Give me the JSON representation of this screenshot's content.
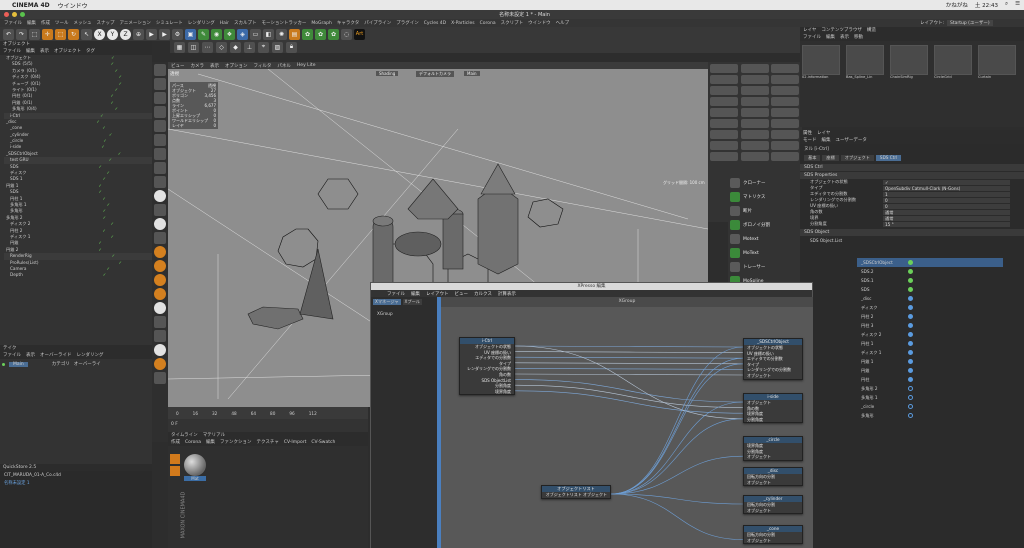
{
  "mac": {
    "app": "CINEMA 4D",
    "menu": "ウインドウ",
    "clock": "土 22:43",
    "user": "かねがね"
  },
  "window_title": "名称未設定 1 * - Main",
  "menubar": [
    "ファイル",
    "編集",
    "作成",
    "ツール",
    "メッシュ",
    "スナップ",
    "アニメーション",
    "シミュレート",
    "レンダリング",
    "Hair",
    "スカルプト",
    "モーショントラッカー",
    "MoGraph",
    "キャラクタ",
    "パイプライン",
    "プラグイン",
    "Cycles 4D",
    "X-Particles",
    "Corona",
    "スクリプト",
    "ウインドウ",
    "ヘルプ"
  ],
  "layout": {
    "label": "レイアウト:",
    "value": "Startup (ユーザー)"
  },
  "toolbar": {
    "x": "X",
    "y": "Y",
    "z": "Z",
    "art": "Art"
  },
  "objects": {
    "header": "オブジェクト",
    "menu": [
      "ファイル",
      "編集",
      "表示",
      "オブジェクト",
      "タグ"
    ],
    "rows": [
      {
        "name": "オブジェクト",
        "v": ""
      },
      {
        "name": "SDS",
        "v": "(5/5)"
      },
      {
        "name": "カメラ",
        "v": "(0/1)"
      },
      {
        "name": "ディスク",
        "v": "(0/4)"
      },
      {
        "name": "チューブ",
        "v": "(0/1)"
      },
      {
        "name": "ライト",
        "v": "(0/1)"
      },
      {
        "name": "円柱",
        "v": "(0/1)"
      },
      {
        "name": "円錐",
        "v": "(0/1)"
      },
      {
        "name": "多角形",
        "v": "(0/4)"
      },
      {
        "name": "i-Ctrl",
        "v": ""
      },
      {
        "name": "_disc",
        "v": ""
      },
      {
        "name": "_cone",
        "v": ""
      },
      {
        "name": "_cylinder",
        "v": ""
      },
      {
        "name": "_circle",
        "v": ""
      },
      {
        "name": "i-side",
        "v": ""
      },
      {
        "name": "_SDSCtrlObject",
        "v": ""
      },
      {
        "name": "test GRU",
        "v": ""
      },
      {
        "name": "SDS",
        "v": ""
      },
      {
        "name": "ディスク",
        "v": ""
      },
      {
        "name": "SDS 1",
        "v": ""
      },
      {
        "name": "円錐 1",
        "v": ""
      },
      {
        "name": "SDS",
        "v": ""
      },
      {
        "name": "円柱 1",
        "v": ""
      },
      {
        "name": "多角形 1",
        "v": ""
      },
      {
        "name": "多角形",
        "v": ""
      },
      {
        "name": "多角形 2",
        "v": ""
      },
      {
        "name": "ディスク 2",
        "v": ""
      },
      {
        "name": "円柱 2",
        "v": ""
      },
      {
        "name": "ディスク 1",
        "v": ""
      },
      {
        "name": "円錐",
        "v": ""
      },
      {
        "name": "円錐 2",
        "v": ""
      },
      {
        "name": "RenderRig",
        "v": ""
      },
      {
        "name": "ProRules(List)",
        "v": ""
      },
      {
        "name": "Camera",
        "v": ""
      },
      {
        "name": "Depth",
        "v": ""
      }
    ]
  },
  "take": {
    "header": "テイク",
    "menu": [
      "ファイル",
      "表示",
      "オーバーライド",
      "レンダリング"
    ],
    "main": "Main",
    "col1": "カテゴリ",
    "col2": "オーバーライ"
  },
  "quickstore": {
    "header": "QuickStore 2.5",
    "file": "CIT_MARUDA_01-A_Co.c4d",
    "sub": "名称未設定 1"
  },
  "viewport": {
    "menu": [
      "ビュー",
      "カメラ",
      "表示",
      "オプション",
      "フィルタ",
      "パネル",
      "Hey Lite"
    ],
    "title_left": "透視",
    "overlay1": "Shading",
    "overlay2": "デフォルトカメラ",
    "overlay3": "Main",
    "hud": [
      [
        "パース",
        "透視"
      ],
      [
        "オブジェクト",
        "27"
      ],
      [
        "",
        ""
      ],
      [
        "ポリゴン",
        "3,456"
      ],
      [
        "点数",
        "3"
      ],
      [
        "ライン",
        "6,677"
      ],
      [
        "ポイント",
        "0"
      ],
      [
        "上昇エリシップ",
        "0"
      ],
      [
        "ワールドエリシップ",
        "0"
      ],
      [
        "レイヤ",
        "0"
      ]
    ],
    "grid_label": "グリッド間隔: 100 cm"
  },
  "timeline": {
    "ticks": [
      "0",
      "16",
      "32",
      "48",
      "64",
      "80",
      "96",
      "112"
    ],
    "frame": "0 F"
  },
  "material": {
    "tabs": [
      "タイムライン",
      "マテリアル"
    ],
    "menu": [
      "作成",
      "Corona",
      "編集",
      "ファンクション",
      "テクスチャ",
      "CV-Import",
      "CV-Swatch"
    ],
    "mat": "Mat",
    "logo1": "MAXON",
    "logo2": "CINEMA4D"
  },
  "objmenu": {
    "items": [
      "クローナー",
      "マトリクス",
      "断片",
      "ボロノイ分割",
      "Motext",
      "MoText",
      "トレーサー",
      "MoSpline",
      "MoExtrude"
    ]
  },
  "content": {
    "tabs": [
      "レイヤ",
      "コンテンツブラウザ",
      "構造"
    ],
    "menu": [
      "ファイル",
      "編集",
      "表示",
      "移動"
    ],
    "thumbs": [
      "02.information",
      "Bas_Spline_Lin",
      "ChainSimRig",
      "CircleGrid",
      "Curtain"
    ]
  },
  "attributes": {
    "tabs": [
      "属性",
      "レイヤ"
    ],
    "menu": [
      "モード",
      "編集",
      "ユーザーデータ"
    ],
    "object": "ヌル [i-Ctrl]",
    "subtabs": [
      "基本",
      "座標",
      "オブジェクト",
      "SDS Ctrl"
    ],
    "section1": "SDS Ctrl",
    "section2": "SDS Properties",
    "rows": [
      {
        "label": "オブジェクトの状態",
        "value": "✓"
      },
      {
        "label": "タイプ",
        "value": "OpenSubdiv Catmull-Clark (N-Gons)"
      },
      {
        "label": "エディタでの分割数",
        "value": "1"
      },
      {
        "label": "レンダリングでの分割数",
        "value": "0"
      },
      {
        "label": "UV 座標の扱い",
        "value": "0"
      },
      {
        "label": "角の数",
        "value": "通常"
      },
      {
        "label": "境界",
        "value": "通常"
      },
      {
        "label": "分割角度",
        "value": "15 °"
      }
    ],
    "section3": "SDS Object",
    "list_label": "SDS Object.List",
    "list": [
      {
        "name": "_SDSCtrlObject",
        "ic": "green"
      },
      {
        "name": "SDS.2",
        "ic": "green"
      },
      {
        "name": "SDS.1",
        "ic": "green"
      },
      {
        "name": "SDS",
        "ic": "green"
      },
      {
        "name": "_disc",
        "ic": "blue"
      },
      {
        "name": "ディスク",
        "ic": "blue"
      },
      {
        "name": "円柱 2",
        "ic": "blue"
      },
      {
        "name": "円柱 3",
        "ic": "blue"
      },
      {
        "name": "ディスク 2",
        "ic": "blue"
      },
      {
        "name": "円柱 1",
        "ic": "blue"
      },
      {
        "name": "ディスク 1",
        "ic": "blue"
      },
      {
        "name": "円錐 1",
        "ic": "blue"
      },
      {
        "name": "円錐",
        "ic": "blue"
      },
      {
        "name": "円柱",
        "ic": "blue"
      },
      {
        "name": "多角形 2",
        "ic": "circle"
      },
      {
        "name": "多角形 1",
        "ic": "circle"
      },
      {
        "name": "_circle",
        "ic": "circle"
      },
      {
        "name": "多角形",
        "ic": "circle"
      }
    ]
  },
  "xpresso": {
    "title": "XPresso 編集",
    "menu": [
      "ファイル",
      "編集",
      "レイアウト",
      "ビュー",
      "カルクス",
      "計算表示"
    ],
    "tabs": [
      "Xマネージャ",
      "Xプール"
    ],
    "group": "XGroup",
    "canvas_title": "XGroup",
    "nodes": [
      {
        "title": "i-Ctrl",
        "ports": [
          "オブジェクトの状態",
          "UV 座標の扱い",
          "エディタでの分割数",
          "タイプ",
          "レンダリングでの分割数",
          "角の数",
          "SDS ObjectList",
          "分割角度",
          "境界角度"
        ]
      },
      {
        "title": "_SDSCtrlObject",
        "ports": [
          "オブジェクトの状態",
          "UV 座標の扱い",
          "エディタでの分割数",
          "タイプ",
          "レンダリングでの分割数",
          "オブジェクト"
        ]
      },
      {
        "title": "i-side",
        "ports": [
          "オブジェクト",
          "角の数",
          "境界角度",
          "分割角度"
        ]
      },
      {
        "title": "_circle",
        "ports": [
          "境界角度",
          "分割角度",
          "オブジェクト"
        ]
      },
      {
        "title": "_disc",
        "ports": [
          "回転方向の分割",
          "オブジェクト"
        ]
      },
      {
        "title": "_cylinder",
        "ports": [
          "回転方向の分割",
          "オブジェクト"
        ]
      },
      {
        "title": "_cone",
        "ports": [
          "回転方向の分割",
          "オブジェクト"
        ]
      },
      {
        "title": "オブジェクトリスト",
        "ports": [
          "オブジェクトリスト オブジェクト"
        ]
      }
    ]
  }
}
